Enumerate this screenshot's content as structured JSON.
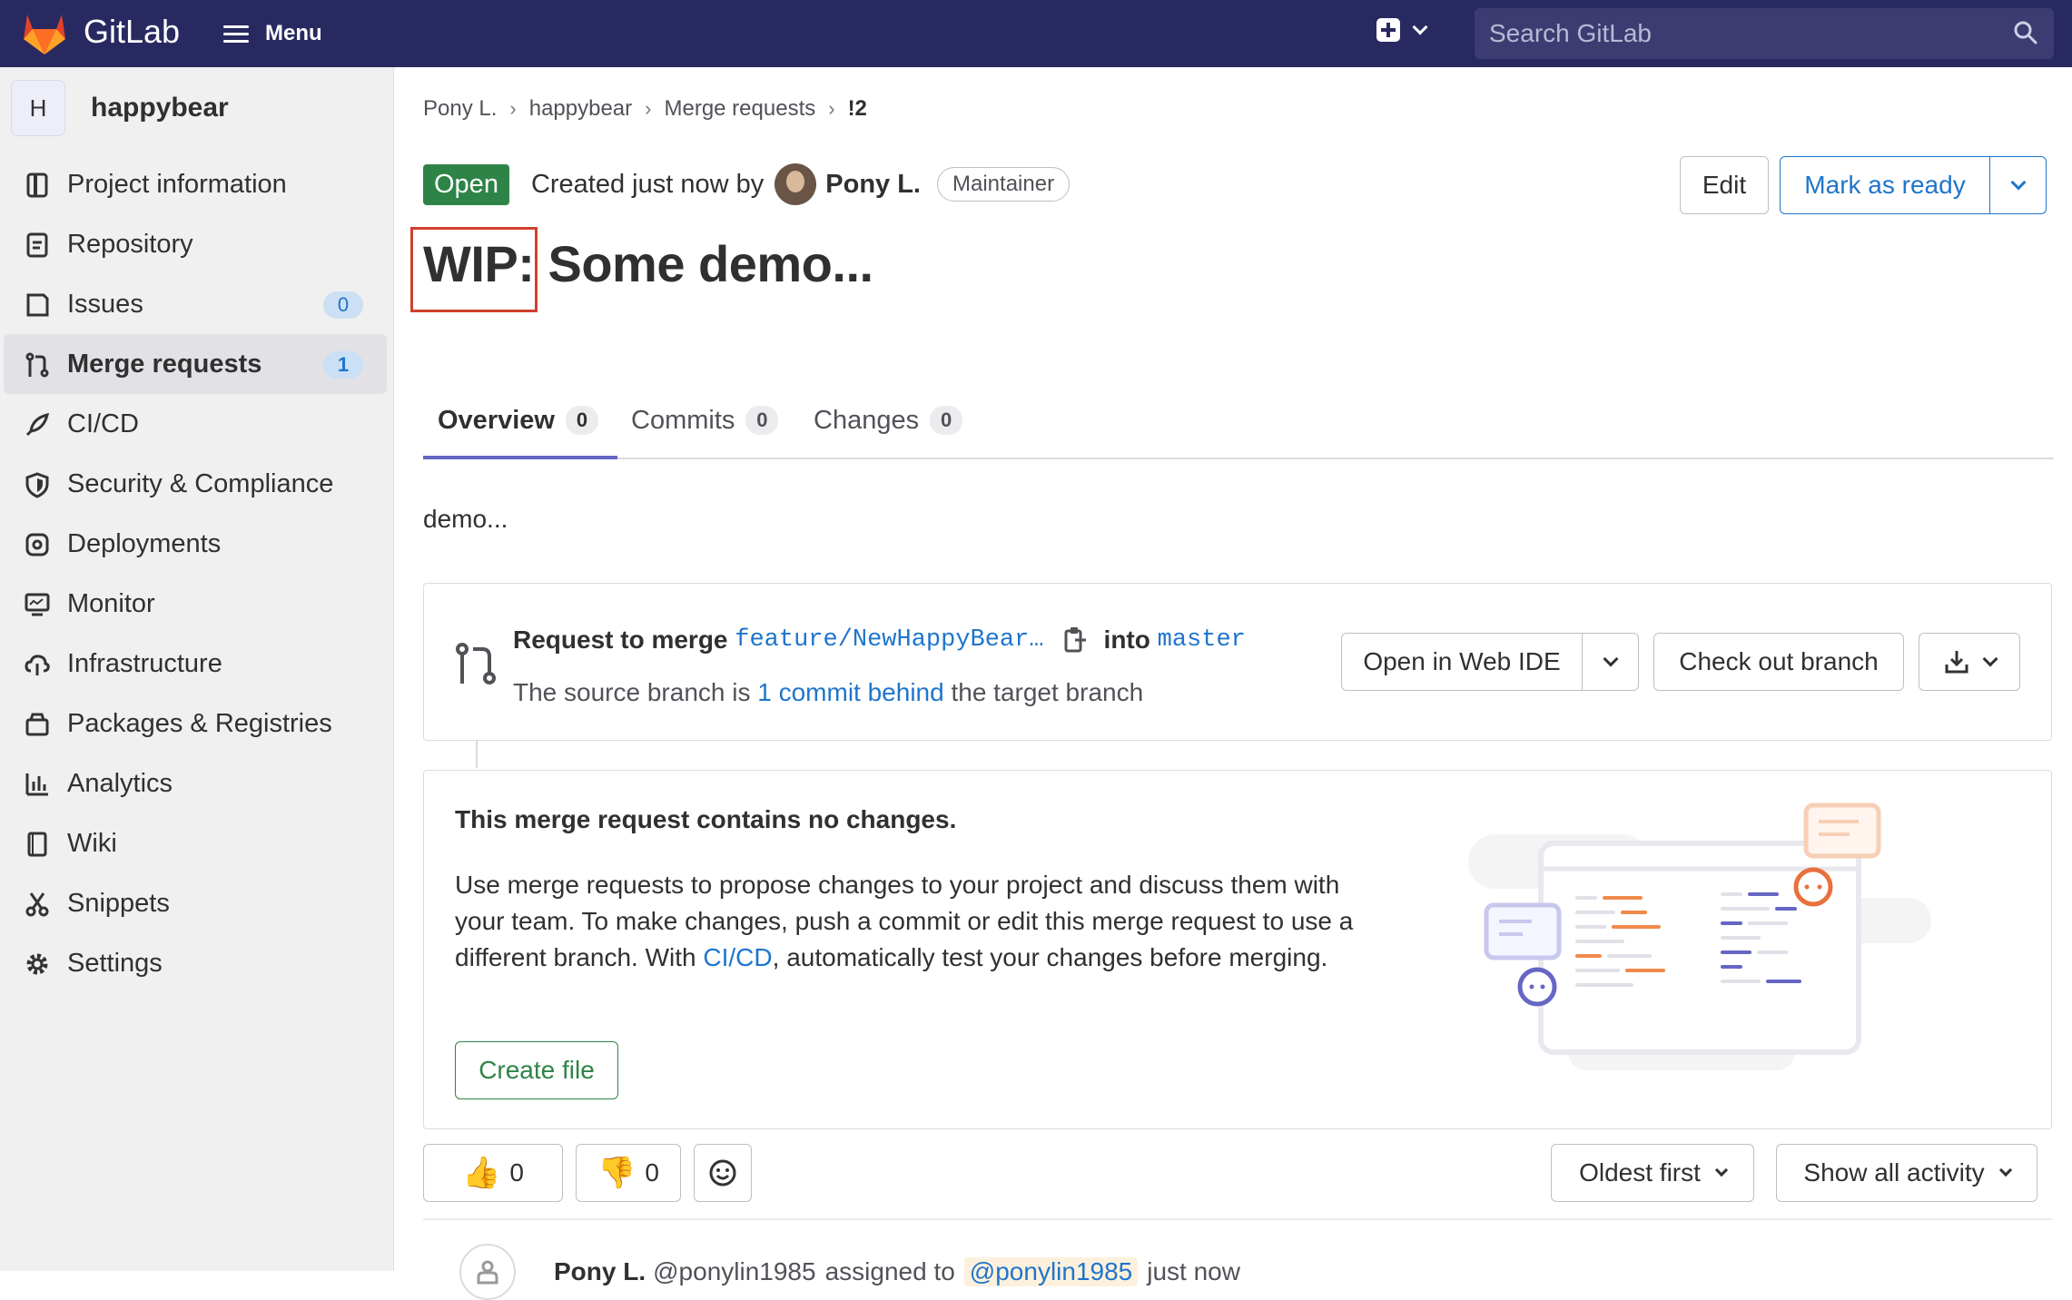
{
  "topbar": {
    "brand": "GitLab",
    "menu_label": "Menu",
    "search_placeholder": "Search GitLab"
  },
  "sidebar": {
    "project_initial": "H",
    "project_name": "happybear",
    "items": [
      {
        "label": "Project information",
        "icon": "info-icon"
      },
      {
        "label": "Repository",
        "icon": "document-icon"
      },
      {
        "label": "Issues",
        "icon": "issues-icon",
        "count": "0"
      },
      {
        "label": "Merge requests",
        "icon": "merge-request-icon",
        "count": "1",
        "active": true
      },
      {
        "label": "CI/CD",
        "icon": "rocket-icon"
      },
      {
        "label": "Security & Compliance",
        "icon": "shield-icon"
      },
      {
        "label": "Deployments",
        "icon": "deployments-icon"
      },
      {
        "label": "Monitor",
        "icon": "monitor-icon"
      },
      {
        "label": "Infrastructure",
        "icon": "cloud-icon"
      },
      {
        "label": "Packages & Registries",
        "icon": "package-icon"
      },
      {
        "label": "Analytics",
        "icon": "chart-icon"
      },
      {
        "label": "Wiki",
        "icon": "book-icon"
      },
      {
        "label": "Snippets",
        "icon": "scissors-icon"
      },
      {
        "label": "Settings",
        "icon": "gear-icon"
      }
    ]
  },
  "breadcrumb": [
    "Pony L.",
    "happybear",
    "Merge requests",
    "!2"
  ],
  "header": {
    "status": "Open",
    "created_text": "Created just now by",
    "author": "Pony L.",
    "role": "Maintainer",
    "edit_label": "Edit",
    "ready_label": "Mark as ready",
    "title_prefix": "WIP:",
    "title_rest": " Some demo..."
  },
  "tabs": [
    {
      "label": "Overview",
      "count": "0",
      "active": true
    },
    {
      "label": "Commits",
      "count": "0"
    },
    {
      "label": "Changes",
      "count": "0"
    }
  ],
  "description": "demo...",
  "merge_widget": {
    "request_label": "Request to merge",
    "source_branch": "feature/NewHappyBear…",
    "into_label": "into",
    "target_branch": "master",
    "status_pre": "The source branch is",
    "status_link": "1 commit behind",
    "status_post": "the target branch",
    "web_ide_label": "Open in Web IDE",
    "checkout_label": "Check out branch"
  },
  "empty_state": {
    "title": "This merge request contains no changes.",
    "body_pre": "Use merge requests to propose changes to your project and discuss them with your team. To make changes, push a commit or edit this merge request to use a different branch. With ",
    "body_link": "CI/CD",
    "body_post": ", automatically test your changes before merging.",
    "button_label": "Create file"
  },
  "reactions": {
    "thumbs_up": "0",
    "thumbs_down": "0"
  },
  "sort": {
    "order_label": "Oldest first",
    "filter_label": "Show all activity"
  },
  "activity": {
    "author": "Pony L.",
    "handle": "@ponylin1985",
    "action": "assigned to",
    "mention": "@ponylin1985",
    "time": "just now"
  }
}
